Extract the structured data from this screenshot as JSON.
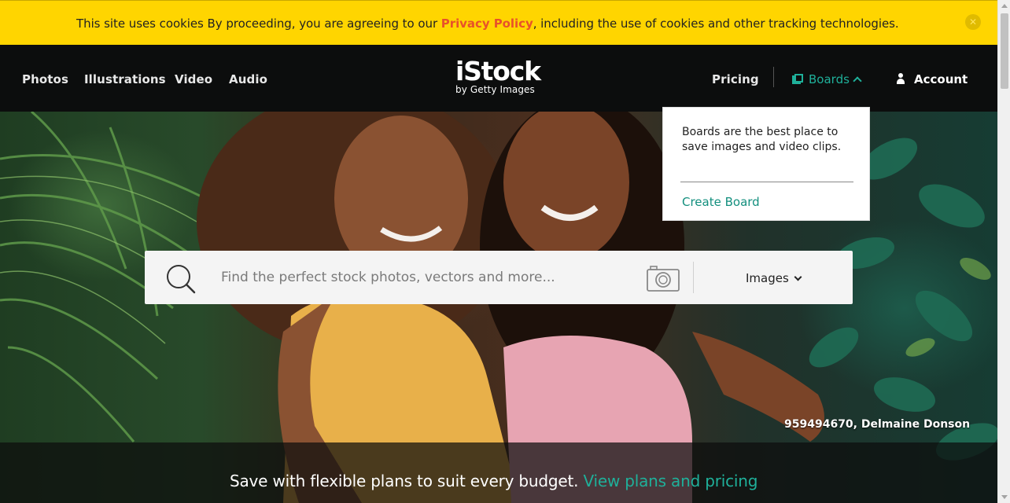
{
  "cookie_bar": {
    "text_before": "This site uses cookies By proceeding, you are agreeing to our ",
    "privacy_link": "Privacy Policy",
    "text_after": ", including the use of cookies and other tracking technologies.",
    "close_icon": "close-icon",
    "close_glyph": "✕"
  },
  "nav": {
    "links": [
      "Photos",
      "Illustrations",
      "Video",
      "Audio"
    ],
    "logo_main": "iStock",
    "logo_sub": "by Getty Images",
    "pricing": "Pricing",
    "boards": "Boards",
    "account": "Account"
  },
  "search": {
    "placeholder": "Find the perfect stock photos, vectors and more...",
    "type": "Images",
    "search_icon": "search-icon",
    "camera_icon": "camera-icon"
  },
  "boards_popover": {
    "text": "Boards are the best place to save images and video clips.",
    "link": "Create Board"
  },
  "hero": {
    "credit": "959494670, Delmaine Donson",
    "promo_text": "Save with flexible plans to suit every budget.",
    "promo_link": "View plans and pricing"
  },
  "colors": {
    "cookie_bg": "#ffd500",
    "privacy_link": "#e8512a",
    "nav_bg": "#0c0d0d",
    "accent": "#1fb09a"
  }
}
